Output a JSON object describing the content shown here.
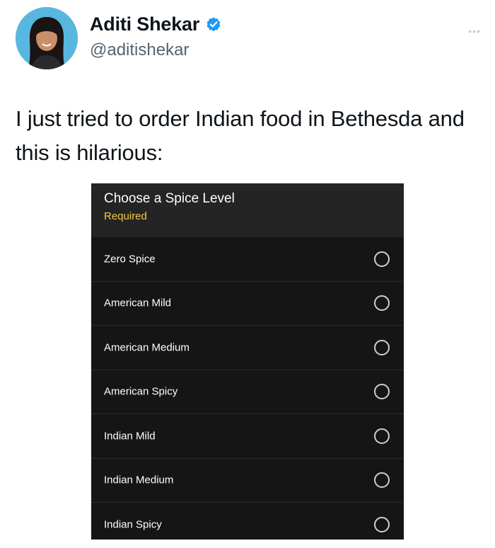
{
  "tweet": {
    "author": {
      "display_name": "Aditi Shekar",
      "handle": "@aditishekar",
      "verified_icon": "verified-badge-icon",
      "verified_color": "#1d9bf0"
    },
    "more_icon": "more-options-icon",
    "text": "I just tried to order Indian food in Bethesda and this is hilarious:"
  },
  "spice_menu": {
    "title": "Choose a Spice Level",
    "required_label": "Required",
    "required_color": "#f2c94c",
    "options": [
      {
        "label": "Zero Spice",
        "selected": false
      },
      {
        "label": "American Mild",
        "selected": false
      },
      {
        "label": "American Medium",
        "selected": false
      },
      {
        "label": "American Spicy",
        "selected": false
      },
      {
        "label": "Indian Mild",
        "selected": false
      },
      {
        "label": "Indian Medium",
        "selected": false
      },
      {
        "label": "Indian Spicy",
        "selected": false
      }
    ]
  }
}
